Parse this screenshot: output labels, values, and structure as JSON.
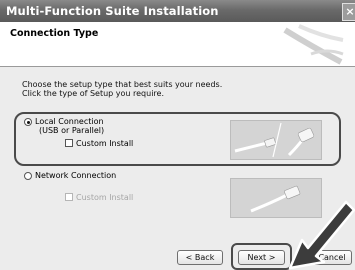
{
  "window": {
    "title": "Multi-Function Suite Installation",
    "close_glyph": "×"
  },
  "header": {
    "title": "Connection Type"
  },
  "instructions": {
    "line1": "Choose the setup type that best suits your needs.",
    "line2": "Click the type of Setup you require."
  },
  "options": {
    "local": {
      "label_line1": "Local Connection",
      "label_line2": "(USB or Parallel)",
      "selected": true,
      "custom_install": "Custom Install",
      "custom_checked": false
    },
    "network": {
      "label": "Network Connection",
      "selected": false,
      "custom_install": "Custom Install",
      "custom_checked": false,
      "custom_disabled": true
    }
  },
  "buttons": {
    "back": "< Back",
    "next": "Next >",
    "cancel": "Cancel"
  },
  "icons": {
    "usb_cable": "usb-parallel-cable-icon",
    "network_cable": "network-cable-icon",
    "pointer": "pointer-arrow-icon"
  }
}
